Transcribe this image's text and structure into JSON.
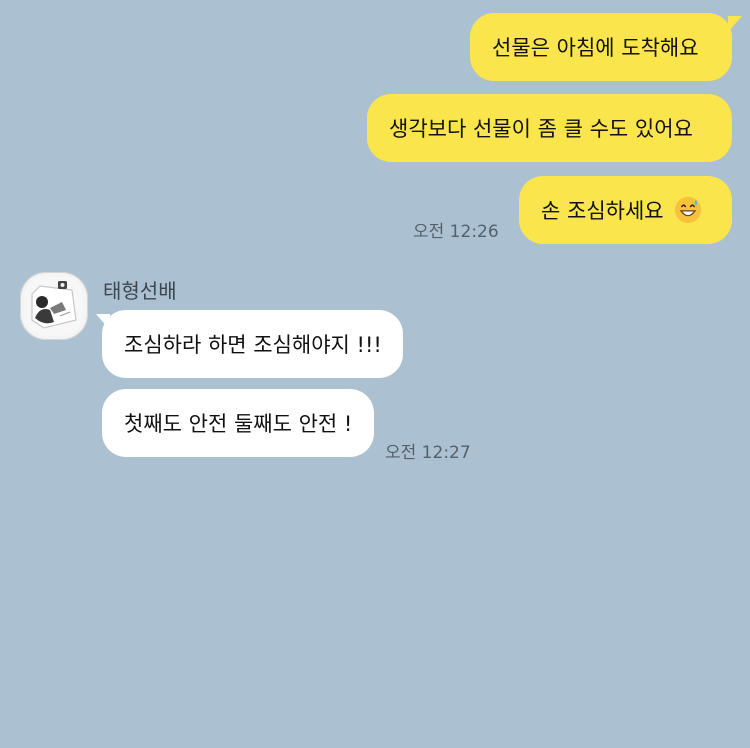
{
  "outgoing": {
    "messages": [
      {
        "text": "선물은 아침에 도착해요"
      },
      {
        "text": "생각보다 선물이 좀 클 수도 있어요"
      },
      {
        "text": "손 조심하세요",
        "emoji": "grinning-sweat-emoji"
      }
    ],
    "time": "오전 12:26"
  },
  "incoming": {
    "sender": "태형선배",
    "avatar_icon": "profile-photo-avatar",
    "messages": [
      {
        "text": "조심하라 하면 조심해야지 !!!"
      },
      {
        "text": "첫째도 안전 둘째도 안전 !"
      }
    ],
    "time": "오전 12:27"
  },
  "colors": {
    "background": "#abc1d1",
    "outgoing_bubble": "#fbe54d",
    "incoming_bubble": "#ffffff",
    "timestamp": "#55606b",
    "sender_name": "#3e4650"
  }
}
